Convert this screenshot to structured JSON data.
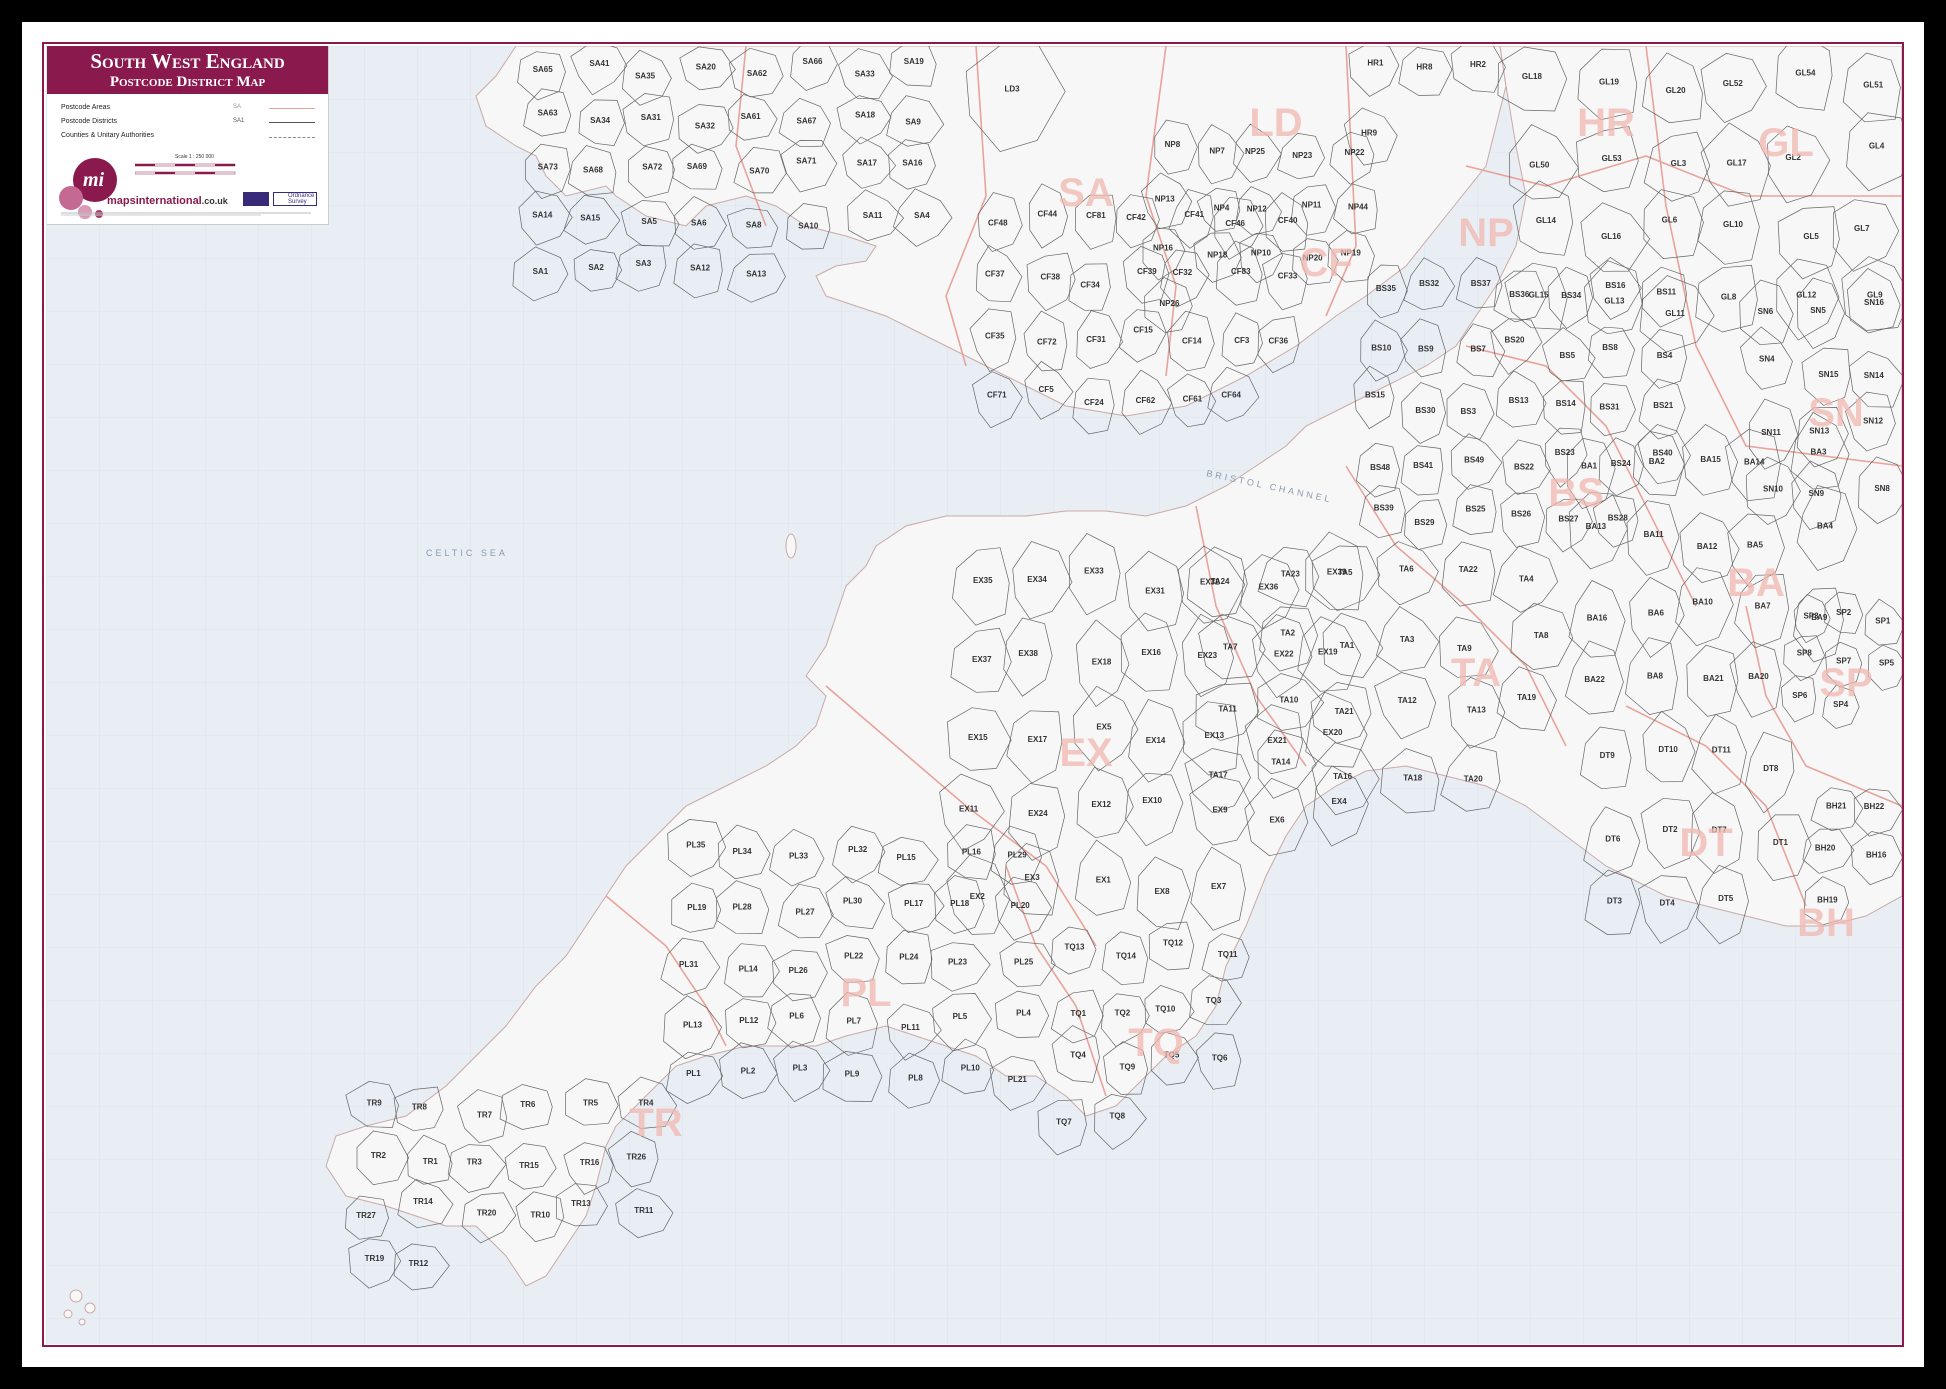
{
  "title": {
    "main": "South West England",
    "subtitle": "Postcode District Map"
  },
  "legend": {
    "items": [
      {
        "label": "Postcode Areas",
        "abbr": "SA",
        "color": "#e8a39a"
      },
      {
        "label": "Postcode Districts",
        "abbr": "SA1",
        "color": "#555555"
      },
      {
        "label": "Counties & Unitary Authorities",
        "abbr": "",
        "color": "#888888"
      }
    ],
    "scale": "Scale 1 : 250 000",
    "brand": "mapsinternational",
    "brand_suffix": ".co.uk",
    "partner": "Ordnance Survey"
  },
  "sea_labels": [
    "BRISTOL CHANNEL",
    "CELTIC SEA"
  ],
  "postcode_areas": [
    "SA",
    "LD",
    "HR",
    "GL",
    "CF",
    "NP",
    "SN",
    "BS",
    "BA",
    "TA",
    "EX",
    "SP",
    "DT",
    "BH",
    "PL",
    "TQ",
    "TR"
  ],
  "districts": {
    "SA": [
      "SA65",
      "SA41",
      "SA35",
      "SA20",
      "SA62",
      "SA66",
      "SA33",
      "SA19",
      "SA63",
      "SA34",
      "SA31",
      "SA32",
      "SA61",
      "SA67",
      "SA18",
      "SA9",
      "SA73",
      "SA68",
      "SA72",
      "SA69",
      "SA70",
      "SA71",
      "SA17",
      "SA16",
      "SA14",
      "SA15",
      "SA5",
      "SA6",
      "SA8",
      "SA10",
      "SA11",
      "SA4",
      "SA1",
      "SA2",
      "SA3",
      "SA12",
      "SA13"
    ],
    "LD": [
      "LD3"
    ],
    "HR": [
      "HR1",
      "HR8",
      "HR2",
      "HR9"
    ],
    "GL": [
      "GL18",
      "GL19",
      "GL20",
      "GL52",
      "GL54",
      "GL51",
      "GL50",
      "GL53",
      "GL3",
      "GL17",
      "GL2",
      "GL4",
      "GL14",
      "GL16",
      "GL6",
      "GL10",
      "GL5",
      "GL7",
      "GL15",
      "GL13",
      "GL11",
      "GL8",
      "GL12",
      "GL9"
    ],
    "NP": [
      "NP8",
      "NP7",
      "NP25",
      "NP23",
      "NP22",
      "NP13",
      "NP4",
      "NP12",
      "NP11",
      "NP44",
      "NP16",
      "NP18",
      "NP10",
      "NP20",
      "NP19",
      "NP26"
    ],
    "CF": [
      "CF48",
      "CF44",
      "CF81",
      "CF42",
      "CF41",
      "CF46",
      "CF40",
      "CF37",
      "CF38",
      "CF34",
      "CF39",
      "CF32",
      "CF83",
      "CF33",
      "CF35",
      "CF72",
      "CF31",
      "CF15",
      "CF14",
      "CF3",
      "CF36",
      "CF71",
      "CF5",
      "CF24",
      "CF62",
      "CF61",
      "CF64"
    ],
    "BS": [
      "BS35",
      "BS32",
      "BS37",
      "BS36",
      "BS34",
      "BS16",
      "BS11",
      "BS10",
      "BS9",
      "BS7",
      "BS20",
      "BS5",
      "BS8",
      "BS4",
      "BS15",
      "BS30",
      "BS3",
      "BS13",
      "BS14",
      "BS31",
      "BS21",
      "BS48",
      "BS41",
      "BS49",
      "BS22",
      "BS23",
      "BS24",
      "BS40",
      "BS39",
      "BS29",
      "BS25",
      "BS26",
      "BS27",
      "BS28"
    ],
    "SN": [
      "SN6",
      "SN5",
      "SN16",
      "SN4",
      "SN15",
      "SN14",
      "SN11",
      "SN13",
      "SN12",
      "SN10",
      "SN9",
      "SN8"
    ],
    "BA": [
      "BA1",
      "BA2",
      "BA15",
      "BA14",
      "BA3",
      "BA13",
      "BA11",
      "BA12",
      "BA5",
      "BA4",
      "BA16",
      "BA6",
      "BA10",
      "BA7",
      "BA9",
      "BA22",
      "BA8",
      "BA21",
      "BA20"
    ],
    "TA": [
      "TA24",
      "TA23",
      "TA5",
      "TA6",
      "TA22",
      "TA4",
      "TA7",
      "TA2",
      "TA1",
      "TA3",
      "TA9",
      "TA8",
      "TA11",
      "TA10",
      "TA21",
      "TA12",
      "TA13",
      "TA19",
      "TA17",
      "TA14",
      "TA16",
      "TA18",
      "TA20"
    ],
    "SP": [
      "SP3",
      "SP2",
      "SP1",
      "SP8",
      "SP7",
      "SP5",
      "SP6",
      "SP4"
    ],
    "DT": [
      "DT9",
      "DT10",
      "DT11",
      "DT8",
      "DT6",
      "DT2",
      "DT7",
      "DT1",
      "DT3",
      "DT4",
      "DT5"
    ],
    "BH": [
      "BH21",
      "BH22",
      "BH20",
      "BH16",
      "BH19"
    ],
    "EX": [
      "EX35",
      "EX34",
      "EX33",
      "EX31",
      "EX32",
      "EX36",
      "EX39",
      "EX37",
      "EX38",
      "EX18",
      "EX16",
      "EX23",
      "EX22",
      "EX19",
      "EX15",
      "EX17",
      "EX5",
      "EX14",
      "EX13",
      "EX21",
      "EX20",
      "EX11",
      "EX24",
      "EX12",
      "EX10",
      "EX9",
      "EX6",
      "EX4",
      "EX2",
      "EX3",
      "EX1",
      "EX8",
      "EX7"
    ],
    "PL": [
      "PL35",
      "PL34",
      "PL33",
      "PL32",
      "PL15",
      "PL16",
      "PL29",
      "PL19",
      "PL28",
      "PL27",
      "PL30",
      "PL17",
      "PL18",
      "PL20",
      "PL31",
      "PL14",
      "PL26",
      "PL22",
      "PL24",
      "PL23",
      "PL25",
      "PL13",
      "PL12",
      "PL6",
      "PL7",
      "PL11",
      "PL5",
      "PL4",
      "PL1",
      "PL2",
      "PL3",
      "PL9",
      "PL8",
      "PL10",
      "PL21"
    ],
    "TQ": [
      "TQ13",
      "TQ14",
      "TQ12",
      "TQ11",
      "TQ1",
      "TQ2",
      "TQ10",
      "TQ3",
      "TQ4",
      "TQ9",
      "TQ5",
      "TQ6",
      "TQ7",
      "TQ8"
    ],
    "TR": [
      "TR9",
      "TR8",
      "TR7",
      "TR6",
      "TR5",
      "TR4",
      "TR2",
      "TR1",
      "TR3",
      "TR15",
      "TR16",
      "TR26",
      "TR27",
      "TR14",
      "TR20",
      "TR10",
      "TR13",
      "TR11",
      "TR19",
      "TR12"
    ]
  },
  "colors": {
    "frame": "#8a1a4e",
    "sea": "#e9eef5",
    "land": "#f7f7f7",
    "area_boundary": "#e8a39a",
    "district_boundary": "#555555",
    "area_label": "#f2b8b0"
  }
}
